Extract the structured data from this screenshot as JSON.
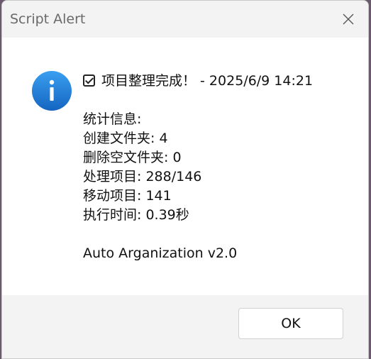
{
  "window": {
    "title": "Script Alert",
    "close_icon": "close-icon"
  },
  "message": {
    "icon": "info-icon",
    "header_check_icon": "checkbox-checked-icon",
    "header": "项目整理完成！ - 2025/6/9 14:21",
    "lines": [
      "统计信息:",
      "创建文件夹: 4",
      "删除空文件夹: 0",
      "处理项目: 288/146",
      "移动项目: 141",
      "执行时间: 0.39秒",
      "",
      "Auto Arganization v2.0"
    ]
  },
  "buttons": {
    "ok_label": "OK"
  },
  "colors": {
    "info_icon_top": "#3a9ff0",
    "info_icon_bottom": "#1565c0",
    "titlebar_bg": "#f3f3f3",
    "footer_bg": "#f3f3f3"
  }
}
